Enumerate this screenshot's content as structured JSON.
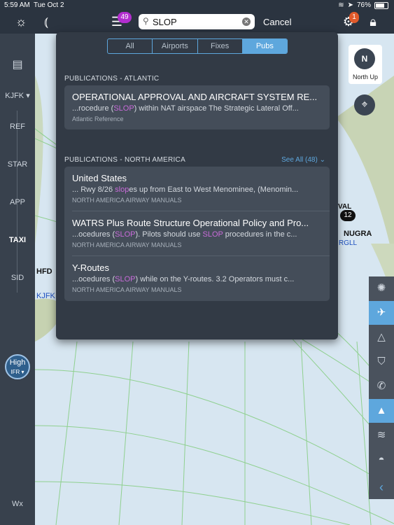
{
  "status": {
    "time": "5:59 AM",
    "date": "Tue Oct 2",
    "battery": "76%"
  },
  "topbar": {
    "list_badge": "49",
    "search_value": "SLOP",
    "cancel": "Cancel",
    "gear_badge": "1"
  },
  "sidebar": {
    "airport": "KJFK ▾",
    "items": [
      "REF",
      "STAR",
      "APP",
      "TAXI",
      "SID"
    ],
    "wx": "Wx",
    "high": "High",
    "ifr": "IFR ▾"
  },
  "map": {
    "north_letter": "N",
    "north_up": "North Up",
    "labels": [
      "HFD",
      "KJFK",
      "NUGRA",
      "12",
      "VAL",
      "RGLL"
    ]
  },
  "panel": {
    "tabs": [
      "All",
      "Airports",
      "Fixes",
      "Pubs"
    ],
    "active_tab": "Pubs",
    "section1": "PUBLICATIONS - ATLANTIC",
    "atlantic": {
      "title": "OPERATIONAL APPROVAL AND AIRCRAFT SYSTEM RE...",
      "snippet_pre": "...rocedure (",
      "snippet_hl": "SLOP",
      "snippet_post": ") within NAT airspace The Strategic Lateral Off...",
      "source": "Atlantic Reference"
    },
    "section2": "PUBLICATIONS - NORTH AMERICA",
    "see_all": "See All (48)",
    "results": [
      {
        "title": "United States",
        "pre": "... Rwy 8/26 ",
        "hl": "slop",
        "post": "es up from East to West Menominee, (Menomin...",
        "source": "NORTH AMERICA AIRWAY MANUALS"
      },
      {
        "title": "WATRS Plus Route Structure Operational Policy and Pro...",
        "pre": "...ocedures (",
        "hl": "SLOP",
        "post": "). Pilots should use ",
        "hl2": "SLOP",
        "post2": " procedures in the c...",
        "source": "NORTH AMERICA AIRWAY MANUALS"
      },
      {
        "title": "Y-Routes",
        "pre": "...ocedures (",
        "hl": "SLOP",
        "post": ") while on the Y-routes. 3.2 Operators must c...",
        "source": "NORTH AMERICA AIRWAY MANUALS"
      }
    ]
  },
  "colors": {
    "accent": "#5ea7dd",
    "highlight": "#c86bd9",
    "badge_list": "#b32ecf",
    "badge_gear": "#e05a2b"
  }
}
